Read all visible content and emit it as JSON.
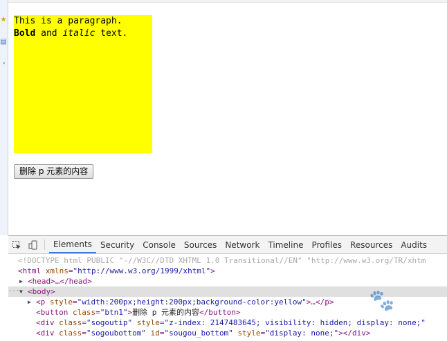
{
  "page": {
    "paragraph": {
      "line1": "This is a paragraph.",
      "bold": "Bold",
      "and": " and ",
      "italic": "italic",
      "text": " text."
    },
    "button_label": "删除 p 元素的内容"
  },
  "devtools": {
    "tabs": [
      "Elements",
      "Security",
      "Console",
      "Sources",
      "Network",
      "Timeline",
      "Profiles",
      "Resources",
      "Audits"
    ],
    "active_tab": "Elements",
    "dom": {
      "doctype": "<!DOCTYPE html PUBLIC \"-//W3C//DTD XHTML 1.0 Transitional//EN\" \"http://www.w3.org/TR/xhtm",
      "html_open_tag": "html",
      "html_attr": "xmlns",
      "html_attr_val": "\"http://www.w3.org/1999/xhtml\"",
      "head_collapsed": "<head>…</head>",
      "body_tag": "<body>",
      "p_tag": "p",
      "p_attr": "style",
      "p_val": "\"width:200px;height:200px;background-color:yellow\"",
      "p_rest": ">…</p>",
      "button_tag": "button",
      "button_attr": "class",
      "button_val": "\"btn1\"",
      "button_text": "删除 p 元素的内容",
      "button_close": "</button>",
      "div1_tag": "div",
      "div1_attr1": "class",
      "div1_val1": "\"sogoutip\"",
      "div1_attr2": "style",
      "div1_val2": "\"z-index: 2147483645; visibility: hidden; display: none;\"",
      "div2_tag": "div",
      "div2_attr1": "class",
      "div2_val1": "\"sogoubottom\"",
      "div2_attr2": "id",
      "div2_val2": "\"sougou_bottom\"",
      "div2_attr3": "style",
      "div2_val3": "\"display: none;\"",
      "div2_rest": "></div>"
    }
  },
  "colors": {
    "paragraph_bg": "#ffff00",
    "tab_active_underline": "#3879d9",
    "tag": "#881280",
    "attr_name": "#994500",
    "attr_value": "#1a1aa6"
  }
}
